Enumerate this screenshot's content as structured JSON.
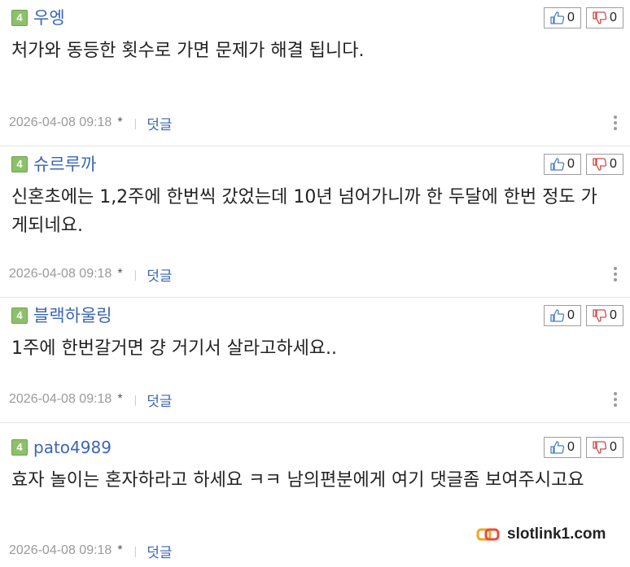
{
  "comments": [
    {
      "level": "4",
      "nickname": "우엥",
      "text": "처가와 동등한 횟수로 가면 문제가 해결 됩니다.",
      "date": "2026-04-08 09:18",
      "star": "*",
      "separator": "|",
      "reply_label": "덧글",
      "likes": "0",
      "dislikes": "0"
    },
    {
      "level": "4",
      "nickname": "슈르루까",
      "text": "신혼초에는 1,2주에 한번씩 갔었는데 10년 넘어가니까 한 두달에 한번 정도 가게되네요.",
      "date": "2026-04-08 09:18",
      "star": "*",
      "separator": "|",
      "reply_label": "덧글",
      "likes": "0",
      "dislikes": "0"
    },
    {
      "level": "4",
      "nickname": "블랙하울링",
      "text": "1주에 한번갈거면 걍 거기서 살라고하세요..",
      "date": "2026-04-08 09:18",
      "star": "*",
      "separator": "|",
      "reply_label": "덧글",
      "likes": "0",
      "dislikes": "0"
    },
    {
      "level": "4",
      "nickname": "pato4989",
      "text": "효자 놀이는 혼자하라고 하세요 ㅋㅋ 남의편분에게 여기 댓글좀 보여주시고요",
      "date": "2026-04-08 09:18",
      "star": "*",
      "separator": "|",
      "reply_label": "덧글",
      "likes": "0",
      "dislikes": "0"
    }
  ],
  "watermark": {
    "text": "slotlink1.com",
    "logo_colors": [
      "#f5a623",
      "#e94e3c"
    ]
  },
  "colors": {
    "nickname": "#3a66b3",
    "level_badge": "#8cc16a",
    "thumb_up": "#4a7fc1",
    "thumb_down": "#c94a4a",
    "meta_text": "#9a9a9a"
  },
  "icons": {
    "like": "thumbs-up-icon",
    "dislike": "thumbs-down-icon",
    "more": "vertical-ellipsis-icon"
  }
}
